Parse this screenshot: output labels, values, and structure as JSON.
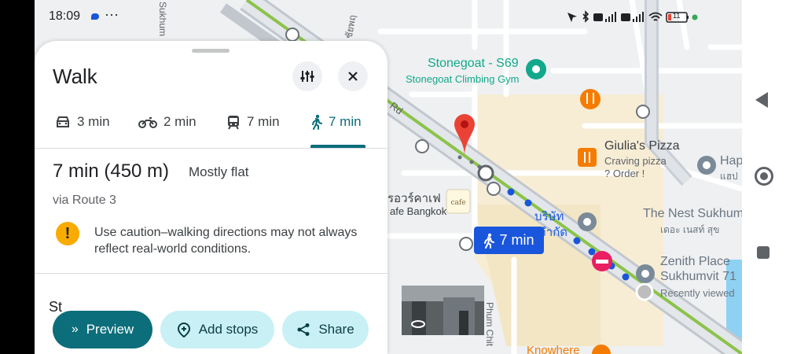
{
  "status": {
    "time": "18:09",
    "more": "···",
    "battery": "11"
  },
  "sheet": {
    "title": "Walk",
    "modes": [
      {
        "name": "car",
        "time": "3 min"
      },
      {
        "name": "motorbike",
        "time": "2 min"
      },
      {
        "name": "transit",
        "time": "7 min"
      },
      {
        "name": "walk",
        "time": "7 min",
        "selected": true
      }
    ],
    "summary": {
      "time_distance": "7 min (450 m)",
      "terrain": "Mostly flat",
      "via": "via Route 3"
    },
    "warning": "Use caution–walking directions may not always reflect real-world conditions.",
    "steps_partial": "St",
    "buttons": {
      "preview": "Preview",
      "add_stops": "Add stops",
      "share": "Share"
    },
    "accent_color": "#0b6e7a"
  },
  "map": {
    "route_badge": "7 min",
    "places": {
      "stonegoat_name": "Stonegoat - S69",
      "stonegoat_sub": "Stonegoat Climbing Gym",
      "giulia_name": "Giulia's Pizza",
      "giulia_sub1": "Craving pizza",
      "giulia_sub2": "? Order !",
      "nest_name": "The Nest Sukhum",
      "nest_thai": "เดอะ เนสท์ สุข",
      "zenith_name1": "Zenith Place",
      "zenith_name2": "Sukhumvit 71",
      "zenith_sub": "Recently viewed",
      "cafe_thai": "รอวร์คาเฟ",
      "cafe_name": "afe Bangkok",
      "hap_name": "Hap",
      "hap_thai": "แฮป",
      "company_thai1": "บริษัท",
      "company_thai2": "จำกัด",
      "knowhere": "Knowhere",
      "road_sukhum": "Sukhum",
      "road_thai": "ซ. ชัยพฤ",
      "road_phum": "Phum Chit",
      "road_rd": "Rd"
    },
    "colors": {
      "route_blue": "#1a56db",
      "road_green": "#8bc34a",
      "poi_orange": "#f57c00",
      "poi_teal": "#12a88b",
      "poi_pink": "#e91e63"
    }
  },
  "navbar": {
    "buttons": [
      "back-icon",
      "home-icon",
      "recents-icon"
    ]
  }
}
